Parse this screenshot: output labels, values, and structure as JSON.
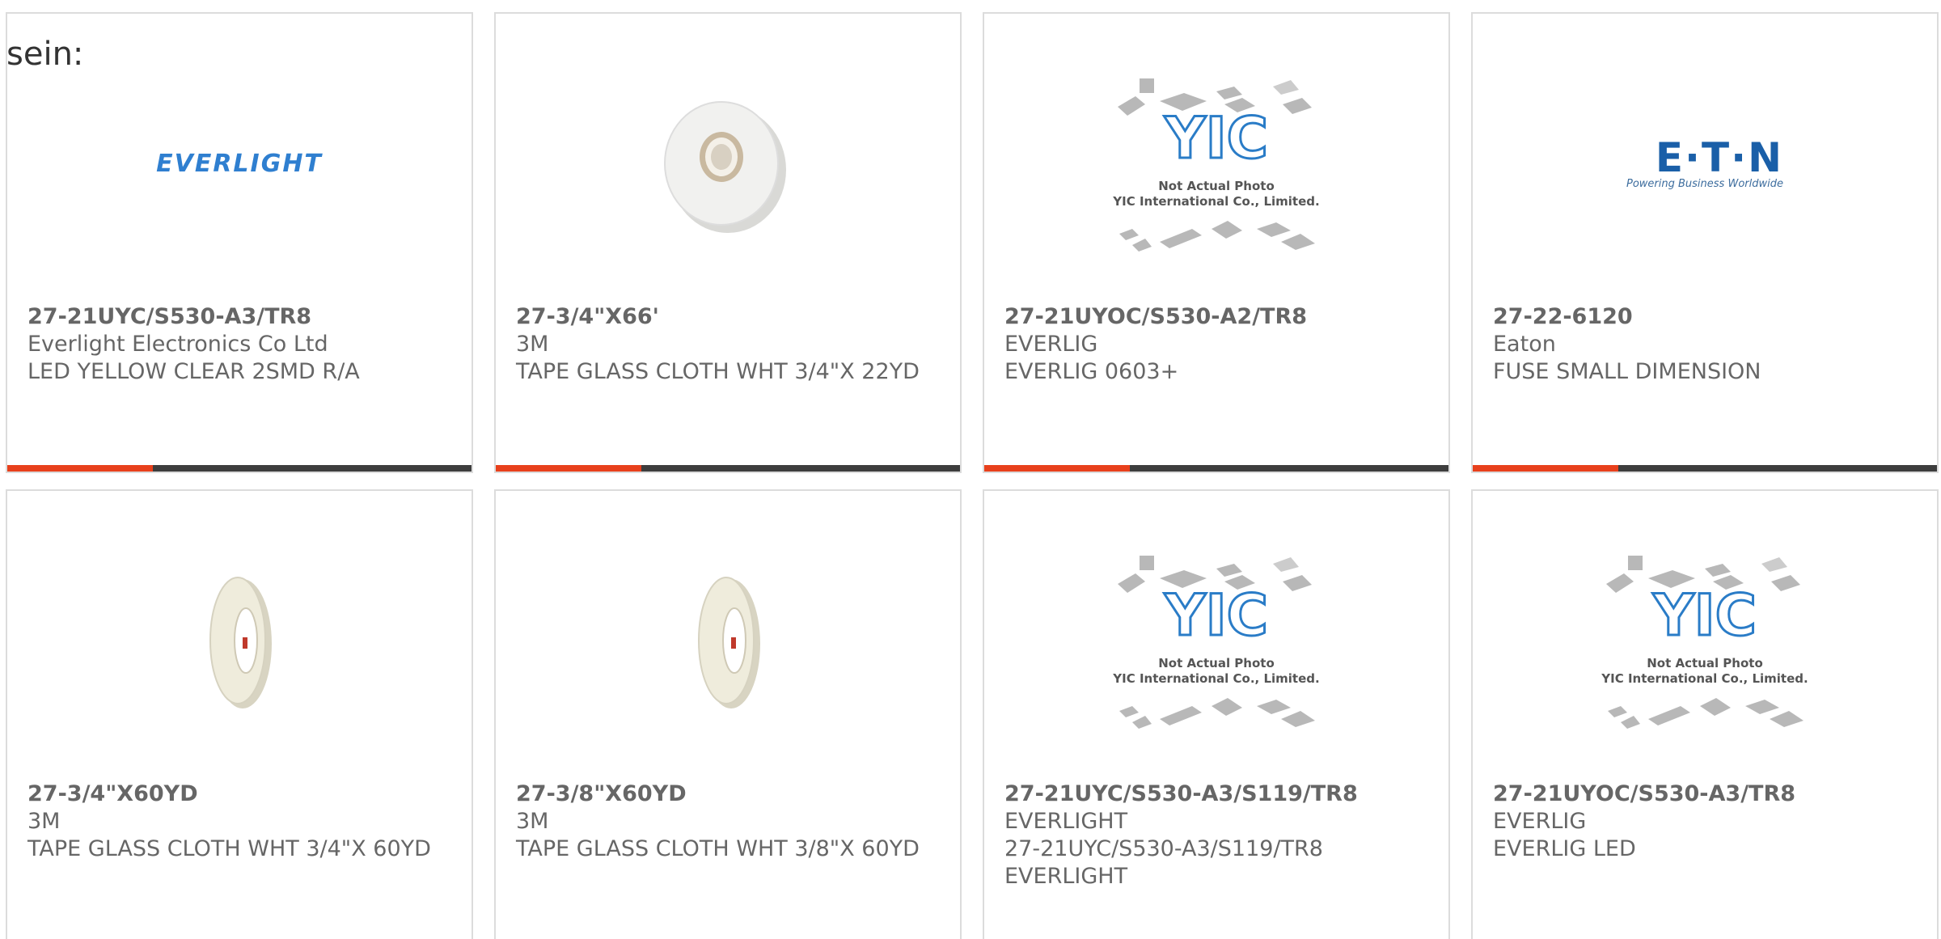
{
  "intro_text": "sein:",
  "colors": {
    "accent": "#e8401c",
    "bar": "#3d3d3d",
    "card_border": "#dcdcdc",
    "text": "#666666",
    "yic_blue": "#2a7cc7"
  },
  "yic_placeholder": {
    "brand": "YIC",
    "line1": "Not Actual Photo",
    "line2": "YIC International Co., Limited."
  },
  "products": [
    {
      "part_number": "27-21UYC/S530-A3/TR8",
      "manufacturer": "Everlight Electronics Co Ltd",
      "description": "LED YELLOW CLEAR 2SMD R/A",
      "image": "everlight-logo",
      "logo_text": "EVERLIGHT"
    },
    {
      "part_number": "27-3/4\"X66'",
      "manufacturer": "3M",
      "description": "TAPE GLASS CLOTH WHT 3/4\"X 22YD",
      "image": "tape-roll-wide"
    },
    {
      "part_number": "27-21UYOC/S530-A2/TR8",
      "manufacturer": "EVERLIG",
      "description": "EVERLIG 0603+",
      "image": "yic-placeholder"
    },
    {
      "part_number": "27-22-6120",
      "manufacturer": "Eaton",
      "description": "FUSE SMALL DIMENSION",
      "image": "eaton-logo",
      "logo_text": "E·T·N",
      "logo_tagline": "Powering Business Worldwide"
    },
    {
      "part_number": "27-3/4\"X60YD",
      "manufacturer": "3M",
      "description": "TAPE GLASS CLOTH WHT 3/4\"X 60YD",
      "image": "tape-roll-narrow"
    },
    {
      "part_number": "27-3/8\"X60YD",
      "manufacturer": "3M",
      "description": "TAPE GLASS CLOTH WHT 3/8\"X 60YD",
      "image": "tape-roll-narrow"
    },
    {
      "part_number": "27-21UYC/S530-A3/S119/TR8",
      "manufacturer": "EVERLIGHT",
      "description": "27-21UYC/S530-A3/S119/TR8 EVERLIGHT",
      "image": "yic-placeholder"
    },
    {
      "part_number": "27-21UYOC/S530-A3/TR8",
      "manufacturer": "EVERLIG",
      "description": "EVERLIG LED",
      "image": "yic-placeholder"
    }
  ]
}
